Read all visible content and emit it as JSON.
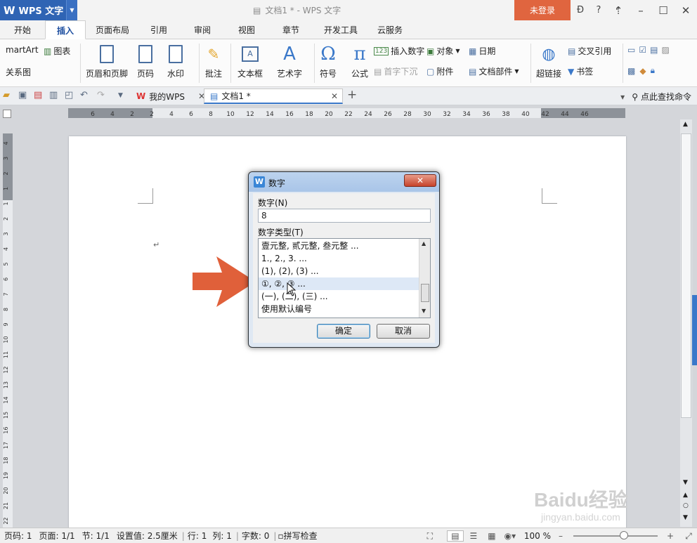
{
  "app": {
    "logo": "W",
    "name": "WPS 文字",
    "window_title": "文档1 * - WPS 文字",
    "login": "未登录"
  },
  "tabs": [
    "开始",
    "插入",
    "页面布局",
    "引用",
    "审阅",
    "视图",
    "章节",
    "开发工具",
    "云服务"
  ],
  "active_tab": "插入",
  "ribbon": {
    "smartart": "martArt",
    "chart": "图表",
    "relation": "关系图",
    "header_footer": "页眉和页脚",
    "page_num": "页码",
    "watermark": "水印",
    "comment": "批注",
    "textbox": "文本框",
    "wordart": "艺术字",
    "symbol": "符号",
    "formula": "公式",
    "insert_number": "插入数字",
    "object": "对象",
    "date": "日期",
    "dropcap": "首字下沉",
    "attachment": "附件",
    "doc_parts": "文档部件",
    "hyperlink": "超链接",
    "crossref": "交叉引用",
    "bookmark": "书签"
  },
  "quick": {
    "my_wps": "我的WPS",
    "doc_tab": "文档1 *",
    "find_cmd": "点此查找命令"
  },
  "ruler": {
    "h_numbers": [
      "6",
      "4",
      "2",
      "2",
      "4",
      "6",
      "8",
      "10",
      "12",
      "14",
      "16",
      "18",
      "20",
      "22",
      "24",
      "26",
      "28",
      "30",
      "32",
      "34",
      "36",
      "38",
      "40",
      "42",
      "44",
      "46"
    ],
    "v_numbers": [
      "4",
      "3",
      "2",
      "1",
      "1",
      "2",
      "3",
      "4",
      "5",
      "6",
      "7",
      "8",
      "9",
      "10",
      "11",
      "12",
      "13",
      "14",
      "15",
      "16",
      "17",
      "18",
      "19",
      "20",
      "21",
      "22"
    ]
  },
  "dialog": {
    "title": "数字",
    "number_label": "数字(N)",
    "number_value": "8",
    "type_label": "数字类型(T)",
    "types": [
      "壹元整, 贰元整, 叁元整 ...",
      "1., 2., 3. ...",
      "(1), (2), (3) ...",
      "①, ②, ③ ...",
      "(一), (二), (三) ...",
      "使用默认编号"
    ],
    "selected_index": 3,
    "ok": "确定",
    "cancel": "取消"
  },
  "status": {
    "page_code": "页码: 1",
    "page": "页面: 1/1",
    "section": "节: 1/1",
    "setting": "设置值: 2.5厘米",
    "line": "行: 1",
    "col": "列: 1",
    "words": "字数: 0",
    "spell": "拼写检查",
    "zoom": "100 %"
  },
  "watermark": {
    "brand": "Baidu经验",
    "url": "jingyan.baidu.com"
  },
  "colors": {
    "brand_blue": "#2f64b4",
    "login_orange": "#e0653f",
    "arrow": "#e0603a"
  }
}
